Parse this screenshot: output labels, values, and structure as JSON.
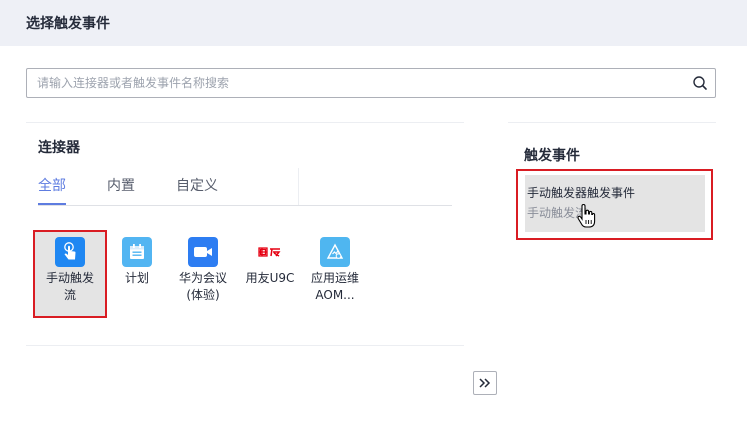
{
  "header": {
    "title": "选择触发事件"
  },
  "search": {
    "placeholder": "请输入连接器或者触发事件名称搜索",
    "value": ""
  },
  "connectors_panel": {
    "title": "连接器",
    "tabs": [
      {
        "label": "全部",
        "active": true
      },
      {
        "label": "内置",
        "active": false
      },
      {
        "label": "自定义",
        "active": false
      }
    ],
    "items": [
      {
        "label": "手动触发\n流",
        "icon": "hand-touch-icon",
        "color": "#1f87f2",
        "selected": true
      },
      {
        "label": "计划",
        "icon": "calendar-icon",
        "color": "#52b5f2",
        "selected": false
      },
      {
        "label": "华为会议\n(体验)",
        "icon": "video-camera-icon",
        "color": "#2d7df2",
        "selected": false
      },
      {
        "label": "用友U9C",
        "icon": "yonyou-logo-icon",
        "color": "#e60012",
        "selected": false
      },
      {
        "label": "应用运维\nAOM...",
        "icon": "aom-icon",
        "color": "#4fb6f0",
        "selected": false
      }
    ]
  },
  "events_panel": {
    "title": "触发事件",
    "items": [
      {
        "name": "手动触发器触发事件",
        "description": "手动触发流"
      }
    ]
  },
  "colors": {
    "accent": "#5e7ce0",
    "highlight_border": "#d91c23",
    "selected_bg": "#e4e4e4"
  }
}
